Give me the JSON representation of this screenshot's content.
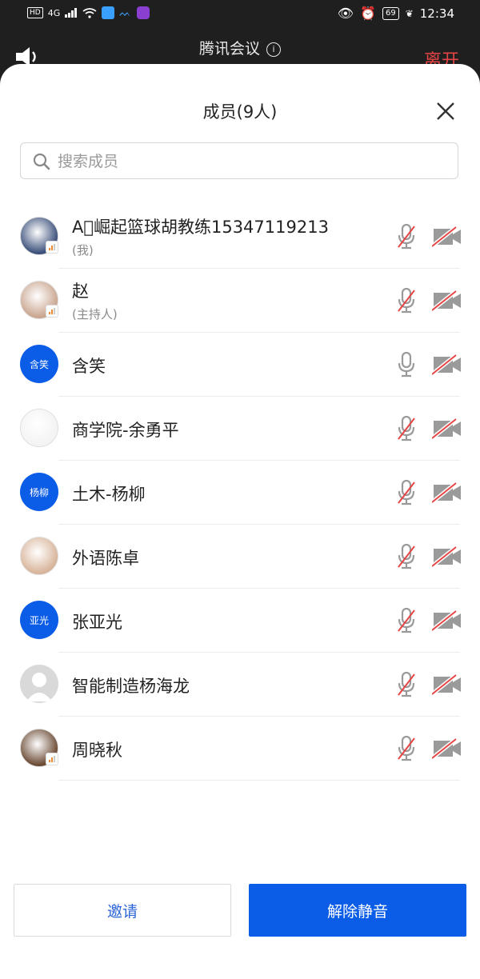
{
  "status_bar": {
    "left_chip": "HD",
    "signal": "4G",
    "battery": "69",
    "time": "12:34"
  },
  "meeting": {
    "title": "腾讯会议",
    "leave": "离开"
  },
  "panel": {
    "title": "成员(9人)",
    "search_placeholder": "搜索成员"
  },
  "members": [
    {
      "name": "A⃞崛起篮球胡教练15347119213",
      "role": "(我)",
      "avatar_kind": "image",
      "avatar_color": "#3a4f7a",
      "speaking_badge": true,
      "mic_muted": true,
      "camera_off": true
    },
    {
      "name": "赵",
      "role": "(主持人)",
      "avatar_kind": "image",
      "avatar_color": "#c9a58f",
      "speaking_badge": true,
      "mic_muted": true,
      "camera_off": true
    },
    {
      "name": "含笑",
      "avatar_text": "含笑",
      "avatar_kind": "text",
      "mic_muted": false,
      "camera_off": true
    },
    {
      "name": "商学院-余勇平",
      "avatar_kind": "image",
      "avatar_color": "#f3f3f3",
      "mic_muted": true,
      "camera_off": true
    },
    {
      "name": "土木-杨柳",
      "avatar_text": "杨柳",
      "avatar_kind": "text",
      "mic_muted": true,
      "camera_off": true
    },
    {
      "name": "外语陈卓",
      "avatar_kind": "image",
      "avatar_color": "#d8b49a",
      "mic_muted": true,
      "camera_off": true
    },
    {
      "name": "张亚光",
      "avatar_text": "亚光",
      "avatar_kind": "text",
      "mic_muted": true,
      "camera_off": true
    },
    {
      "name": "智能制造杨海龙",
      "avatar_kind": "default",
      "avatar_color": "#d9d9d9",
      "mic_muted": true,
      "camera_off": true
    },
    {
      "name": "周晓秋",
      "avatar_kind": "image",
      "avatar_color": "#6b4a34",
      "speaking_badge": true,
      "mic_muted": true,
      "camera_off": true
    }
  ],
  "buttons": {
    "invite": "邀请",
    "unmute_all": "解除静音"
  },
  "colors": {
    "primary": "#0b5ce6",
    "danger": "#e54545",
    "muted_icon": "#9a9a9a"
  }
}
